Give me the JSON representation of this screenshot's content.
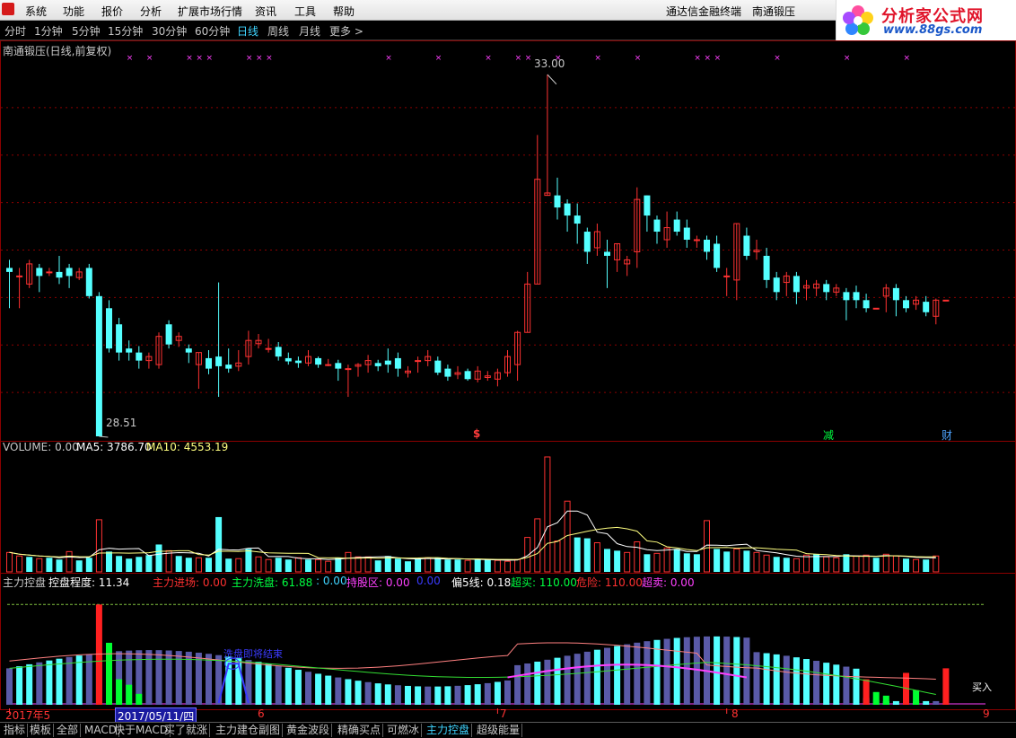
{
  "menu": {
    "items": [
      "系统",
      "功能",
      "报价",
      "分析",
      "扩展市场行情",
      "资讯",
      "工具",
      "帮助"
    ],
    "right_title": "通达信金融终端",
    "right_stock": "南通锻压"
  },
  "watermark": {
    "title": "分析家公式网",
    "url": "www.88gs.com"
  },
  "periods": {
    "items": [
      "分时",
      "1分钟",
      "5分钟",
      "15分钟",
      "30分钟",
      "60分钟",
      "日线",
      "周线",
      "月线",
      "更多 >"
    ],
    "active": "日线"
  },
  "main": {
    "title": "南通锻压(日线,前复权)",
    "high_label": "33.00",
    "low_label": "28.51",
    "markers": [
      {
        "text": "$",
        "color": "#ff3c3c"
      },
      {
        "text": "减",
        "color": "#00ff40"
      },
      {
        "text": "财",
        "color": "#4da3ff"
      }
    ]
  },
  "volume": {
    "label": "VOLUME: 0.00",
    "ma5": "MA5: 3786.70",
    "ma10": "MA10: 4553.19"
  },
  "indicator": {
    "name": "主力控盘",
    "items": [
      {
        "label": "控盘程度: 11.34",
        "color": "#ffffff"
      },
      {
        "label": "主力进场: 0.00",
        "color": "#ff3030"
      },
      {
        "label": "主力洗盘: 61.88",
        "color": "#00ff40"
      },
      {
        "label": ": 0.00",
        "color": "#3fd4ff"
      },
      {
        "label": "持股区: 0.00",
        "color": "#ff40ff"
      },
      {
        "label": "0.00",
        "color": "#3b3bff"
      },
      {
        "label": "偏5线: 0.18",
        "color": "#ffffff"
      },
      {
        "label": "超买: 110.00",
        "color": "#00ff40"
      },
      {
        "label": "危险: 110.00",
        "color": "#ff3030"
      },
      {
        "label": "超卖: 0.00",
        "color": "#ff40ff"
      }
    ],
    "annotation": "洗盘即将结束",
    "bottom_flag": "买入"
  },
  "xaxis": {
    "labels": [
      "2017年5",
      "6",
      "7",
      "8",
      "9"
    ],
    "cursor_date": "2017/05/11/四"
  },
  "tabs": {
    "items": [
      "指标",
      "模板",
      "全部",
      "MACD",
      "快于MACD",
      "买了就涨",
      "主力建仓副图",
      "黄金波段",
      "精确买点",
      "可燃冰",
      "主力控盘",
      "超级能量"
    ],
    "active": "主力控盘"
  },
  "colors": {
    "up": "#ff3232",
    "down": "#54ffff",
    "grid": "#8b0000",
    "ma5": "#ffffff",
    "ma10": "#ffff80"
  },
  "chart_data": {
    "type": "candlestick",
    "y_range": [
      28.51,
      33.0
    ],
    "candles": [
      [
        30.6,
        30.55,
        30.7,
        30.1
      ],
      [
        30.5,
        30.5,
        30.6,
        30.1
      ],
      [
        30.4,
        30.65,
        30.7,
        30.35
      ],
      [
        30.6,
        30.5,
        30.65,
        30.3
      ],
      [
        30.55,
        30.55,
        30.6,
        30.5
      ],
      [
        30.55,
        30.48,
        30.75,
        30.4
      ],
      [
        30.6,
        30.5,
        30.65,
        30.35
      ],
      [
        30.48,
        30.55,
        30.6,
        30.45
      ],
      [
        30.6,
        30.25,
        30.65,
        30.22
      ],
      [
        30.25,
        28.51,
        30.3,
        28.51
      ],
      [
        30.1,
        29.6,
        30.2,
        29.55
      ],
      [
        29.9,
        29.55,
        29.98,
        29.45
      ],
      [
        29.6,
        29.55,
        29.7,
        29.45
      ],
      [
        29.55,
        29.45,
        29.63,
        29.35
      ],
      [
        29.45,
        29.5,
        29.55,
        29.35
      ],
      [
        29.4,
        29.75,
        29.8,
        29.35
      ],
      [
        29.9,
        29.65,
        29.95,
        29.6
      ],
      [
        29.7,
        29.75,
        29.8,
        29.62
      ],
      [
        29.6,
        29.55,
        29.65,
        29.42
      ],
      [
        29.4,
        29.55,
        29.55,
        29.1
      ],
      [
        29.48,
        29.35,
        29.58,
        29.28
      ],
      [
        29.5,
        29.38,
        30.42,
        29.0
      ],
      [
        29.4,
        29.35,
        29.6,
        29.3
      ],
      [
        29.38,
        29.42,
        29.58,
        29.32
      ],
      [
        29.5,
        29.7,
        29.82,
        29.4
      ],
      [
        29.66,
        29.7,
        29.78,
        29.6
      ],
      [
        29.6,
        29.6,
        29.72,
        29.55
      ],
      [
        29.62,
        29.5,
        29.68,
        29.45
      ],
      [
        29.48,
        29.44,
        29.55,
        29.4
      ],
      [
        29.45,
        29.42,
        29.5,
        29.36
      ],
      [
        29.42,
        29.5,
        29.58,
        29.38
      ],
      [
        29.48,
        29.4,
        29.5,
        29.36
      ],
      [
        29.4,
        29.4,
        29.47,
        29.38
      ],
      [
        29.42,
        29.35,
        29.46,
        29.2
      ],
      [
        29.35,
        29.35,
        29.4,
        29.0
      ],
      [
        29.38,
        29.4,
        29.42,
        29.25
      ],
      [
        29.4,
        29.45,
        29.52,
        29.3
      ],
      [
        29.42,
        29.38,
        29.46,
        29.32
      ],
      [
        29.45,
        29.4,
        29.6,
        29.3
      ],
      [
        29.48,
        29.35,
        29.55,
        29.25
      ],
      [
        29.3,
        29.32,
        29.38,
        29.24
      ],
      [
        29.45,
        29.45,
        29.5,
        29.3
      ],
      [
        29.45,
        29.5,
        29.58,
        29.38
      ],
      [
        29.45,
        29.3,
        29.5,
        29.27
      ],
      [
        29.35,
        29.25,
        29.4,
        29.2
      ],
      [
        29.28,
        29.3,
        29.38,
        29.22
      ],
      [
        29.32,
        29.22,
        29.35,
        29.2
      ],
      [
        29.22,
        29.32,
        29.38,
        29.18
      ],
      [
        29.24,
        29.26,
        29.32,
        29.2
      ],
      [
        29.22,
        29.3,
        29.35,
        29.13
      ],
      [
        29.3,
        29.5,
        29.58,
        29.25
      ],
      [
        29.4,
        29.8,
        29.82,
        29.2
      ],
      [
        29.8,
        30.4,
        30.55,
        29.8
      ],
      [
        30.4,
        31.7,
        32.25,
        30.4
      ],
      [
        31.5,
        31.53,
        33.0,
        31.5
      ],
      [
        31.5,
        31.35,
        31.72,
        31.2
      ],
      [
        31.4,
        31.25,
        31.45,
        31.05
      ],
      [
        31.25,
        31.15,
        31.4,
        30.9
      ],
      [
        31.05,
        30.8,
        31.1,
        30.65
      ],
      [
        30.85,
        31.05,
        31.15,
        30.75
      ],
      [
        30.8,
        30.75,
        30.95,
        30.35
      ],
      [
        30.7,
        30.9,
        30.9,
        30.55
      ],
      [
        30.65,
        30.7,
        30.75,
        30.5
      ],
      [
        30.8,
        31.45,
        31.6,
        30.6
      ],
      [
        31.5,
        31.25,
        31.5,
        31.05
      ],
      [
        31.2,
        31.05,
        31.25,
        30.9
      ],
      [
        30.95,
        31.1,
        31.3,
        30.85
      ],
      [
        31.2,
        31.05,
        31.3,
        31.0
      ],
      [
        31.1,
        30.95,
        31.2,
        30.85
      ],
      [
        30.95,
        30.95,
        31.0,
        30.85
      ],
      [
        30.95,
        30.8,
        31.0,
        30.7
      ],
      [
        30.9,
        30.6,
        31.0,
        30.55
      ],
      [
        30.5,
        30.5,
        30.6,
        30.25
      ],
      [
        30.45,
        31.15,
        31.15,
        30.2
      ],
      [
        31.0,
        30.75,
        31.1,
        30.7
      ],
      [
        30.8,
        30.82,
        30.95,
        30.7
      ],
      [
        30.75,
        30.45,
        30.85,
        30.35
      ],
      [
        30.48,
        30.3,
        30.55,
        30.2
      ],
      [
        30.42,
        30.5,
        30.55,
        30.25
      ],
      [
        30.5,
        30.3,
        30.55,
        30.15
      ],
      [
        30.35,
        30.38,
        30.45,
        30.2
      ],
      [
        30.35,
        30.4,
        30.45,
        30.25
      ],
      [
        30.4,
        30.3,
        30.45,
        30.2
      ],
      [
        30.3,
        30.35,
        30.4,
        30.25
      ],
      [
        30.3,
        30.2,
        30.35,
        29.95
      ],
      [
        30.3,
        30.2,
        30.38,
        30.1
      ],
      [
        30.2,
        30.1,
        30.28,
        30.05
      ],
      [
        30.1,
        30.1,
        30.1,
        30.1
      ],
      [
        30.25,
        30.35,
        30.4,
        30.05
      ],
      [
        30.35,
        30.2,
        30.4,
        30.0
      ],
      [
        30.2,
        30.1,
        30.25,
        30.05
      ],
      [
        30.15,
        30.2,
        30.25,
        30.08
      ],
      [
        30.18,
        30.05,
        30.25,
        30.0
      ],
      [
        30.0,
        30.2,
        30.22,
        29.9
      ],
      [
        30.2,
        30.2,
        30.2,
        30.2
      ]
    ],
    "volume": [
      [
        1,
        220
      ],
      [
        1,
        180
      ],
      [
        0,
        170
      ],
      [
        1,
        150
      ],
      [
        0,
        160
      ],
      [
        0,
        140
      ],
      [
        1,
        230
      ],
      [
        0,
        130
      ],
      [
        0,
        160
      ],
      [
        1,
        590
      ],
      [
        0,
        230
      ],
      [
        0,
        180
      ],
      [
        0,
        150
      ],
      [
        0,
        170
      ],
      [
        0,
        190
      ],
      [
        0,
        310
      ],
      [
        1,
        240
      ],
      [
        0,
        180
      ],
      [
        0,
        160
      ],
      [
        1,
        160
      ],
      [
        0,
        160
      ],
      [
        0,
        620
      ],
      [
        0,
        150
      ],
      [
        1,
        150
      ],
      [
        0,
        260
      ],
      [
        1,
        170
      ],
      [
        1,
        140
      ],
      [
        0,
        160
      ],
      [
        0,
        140
      ],
      [
        1,
        160
      ],
      [
        0,
        140
      ],
      [
        1,
        140
      ],
      [
        1,
        120
      ],
      [
        0,
        160
      ],
      [
        1,
        220
      ],
      [
        1,
        170
      ],
      [
        1,
        170
      ],
      [
        0,
        130
      ],
      [
        0,
        180
      ],
      [
        0,
        150
      ],
      [
        0,
        120
      ],
      [
        0,
        150
      ],
      [
        1,
        160
      ],
      [
        0,
        160
      ],
      [
        0,
        140
      ],
      [
        0,
        140
      ],
      [
        1,
        130
      ],
      [
        0,
        140
      ],
      [
        0,
        140
      ],
      [
        1,
        130
      ],
      [
        1,
        120
      ],
      [
        1,
        140
      ],
      [
        1,
        390
      ],
      [
        1,
        600
      ],
      [
        1,
        1300
      ],
      [
        1,
        350
      ],
      [
        1,
        800
      ],
      [
        0,
        390
      ],
      [
        0,
        380
      ],
      [
        1,
        330
      ],
      [
        0,
        260
      ],
      [
        0,
        240
      ],
      [
        1,
        220
      ],
      [
        1,
        340
      ],
      [
        0,
        200
      ],
      [
        1,
        210
      ],
      [
        1,
        270
      ],
      [
        0,
        260
      ],
      [
        0,
        210
      ],
      [
        0,
        200
      ],
      [
        1,
        580
      ],
      [
        0,
        260
      ],
      [
        0,
        230
      ],
      [
        1,
        260
      ],
      [
        0,
        240
      ],
      [
        1,
        220
      ],
      [
        1,
        190
      ],
      [
        0,
        170
      ],
      [
        0,
        160
      ],
      [
        1,
        150
      ],
      [
        1,
        190
      ],
      [
        0,
        200
      ],
      [
        1,
        170
      ],
      [
        1,
        160
      ],
      [
        0,
        200
      ],
      [
        1,
        180
      ],
      [
        1,
        190
      ],
      [
        0,
        160
      ],
      [
        1,
        200
      ],
      [
        1,
        180
      ],
      [
        0,
        150
      ],
      [
        1,
        140
      ],
      [
        0,
        140
      ],
      [
        1,
        180
      ],
      [
        0,
        0
      ]
    ]
  }
}
